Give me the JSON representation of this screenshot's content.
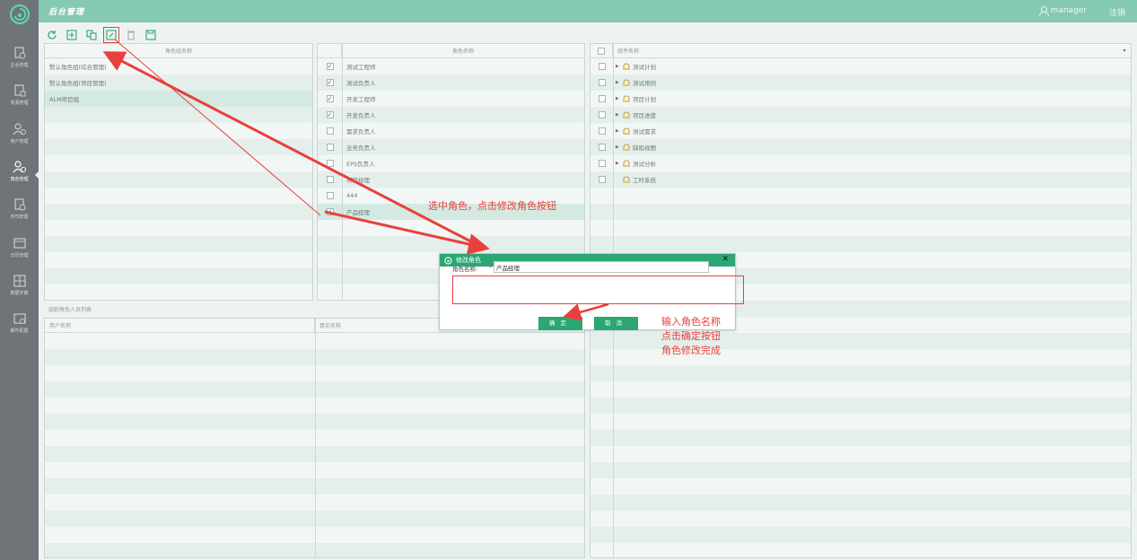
{
  "app": {
    "title": "后台管理",
    "username": "manager",
    "logout": "注销"
  },
  "sidebar": {
    "items": [
      {
        "label": "企业管理",
        "icon": "enterprise-icon"
      },
      {
        "label": "资源管理",
        "icon": "resource-icon"
      },
      {
        "label": "用户管理",
        "icon": "users-icon"
      },
      {
        "label": "角色管理",
        "icon": "roles-icon",
        "active": true
      },
      {
        "label": "EPS管理",
        "icon": "eps-icon"
      },
      {
        "label": "日历管理",
        "icon": "calendar-icon"
      },
      {
        "label": "数据字典",
        "icon": "dictionary-icon"
      },
      {
        "label": "邮件配置",
        "icon": "mail-icon"
      }
    ]
  },
  "toolbar": {
    "buttons": [
      "refresh-icon",
      "add-icon",
      "copy-icon",
      "edit-icon",
      "delete-icon",
      "save-icon"
    ]
  },
  "role_groups": {
    "header": "角色组名称",
    "rows": [
      "默认角色组(综合管理)",
      "默认角色组(项目管理)",
      "ALM项目组"
    ],
    "selected_index": 2
  },
  "roles": {
    "header": "角色名称",
    "rows": [
      {
        "name": "测试工程师",
        "checked": true
      },
      {
        "name": "测试负责人",
        "checked": true
      },
      {
        "name": "开发工程师",
        "checked": true
      },
      {
        "name": "开发负责人",
        "checked": true
      },
      {
        "name": "需求负责人",
        "checked": false
      },
      {
        "name": "业务负责人",
        "checked": false
      },
      {
        "name": "EPS负责人",
        "checked": false
      },
      {
        "name": "项目经理",
        "checked": false
      },
      {
        "name": "444",
        "checked": false
      },
      {
        "name": "产品经理",
        "checked": true
      }
    ],
    "selected_index": 9
  },
  "components": {
    "header": "组件名称",
    "rows": [
      {
        "name": "测试计划",
        "expandable": true
      },
      {
        "name": "测试用例",
        "expandable": true
      },
      {
        "name": "项目计划",
        "expandable": true
      },
      {
        "name": "项目进度",
        "expandable": true
      },
      {
        "name": "测试需求",
        "expandable": true
      },
      {
        "name": "缺陷视图",
        "expandable": true
      },
      {
        "name": "测试分析",
        "expandable": true
      },
      {
        "name": "工时系统",
        "expandable": false
      }
    ]
  },
  "members": {
    "caption": "组织角色人员列表",
    "col1": "用户名称",
    "col2": "真实名称"
  },
  "dialog": {
    "title": "修改角色",
    "field_label": "角色名称:",
    "required_mark": "*",
    "field_value": "产品经理",
    "ok": "确定",
    "cancel": "取消"
  },
  "annotations": {
    "step1": "选中角色，点击修改角色按钮",
    "step2": [
      "输入角色名称",
      "点击确定按钮",
      "角色修改完成"
    ]
  },
  "colors": {
    "topbar": "#85c9b2",
    "sidebar": "#6e7478",
    "accent": "#2ca774",
    "annotation": "#e8403c"
  }
}
